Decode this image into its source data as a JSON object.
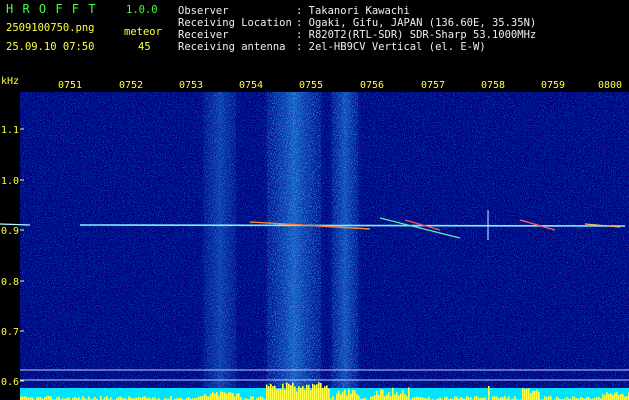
{
  "app": {
    "title": "H R O F F T",
    "version": "1.0.0",
    "filename": "2509100750.png",
    "datetime": "25.09.10 07:50",
    "meteor_label": "meteor",
    "meteor_count": "45"
  },
  "info": {
    "labels": [
      "Observer",
      "Receiving Location",
      "Receiver",
      "Receiving antenna"
    ],
    "values": [
      ": Takanori Kawachi",
      ": Ogaki, Gifu, JAPAN (136.60E, 35.35N)",
      ": R820T2(RTL-SDR) SDR-Sharp 53.1000MHz",
      ": 2el-HB9CV Vertical (el. E-W)"
    ]
  },
  "axis": {
    "unit": "kHz",
    "times": [
      "0751",
      "0752",
      "0753",
      "0754",
      "0755",
      "0756",
      "0757",
      "0758",
      "0759",
      "0800"
    ],
    "freqs": [
      "1.1",
      "1.0",
      "0.9",
      "0.8",
      "0.7",
      "0.6"
    ]
  },
  "colors": {
    "yellow": "#ffff44",
    "green": "#44ff44",
    "background": "#00007a",
    "cyan": "#00e5ff"
  }
}
